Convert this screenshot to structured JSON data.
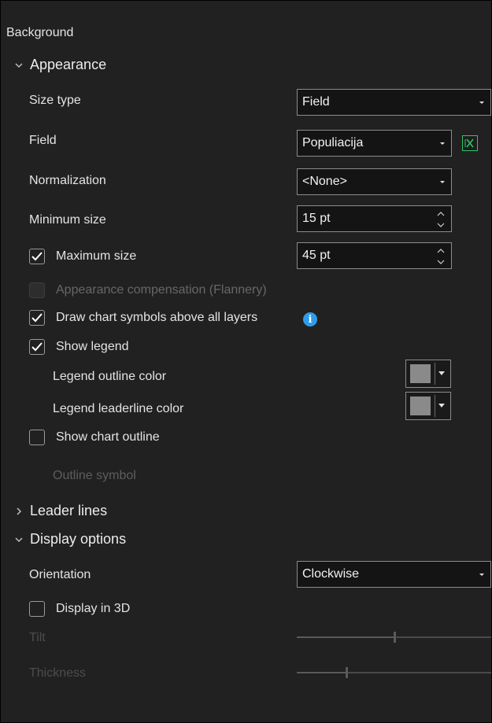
{
  "header": {
    "title": "Background"
  },
  "appearance": {
    "section_title": "Appearance",
    "size_type": {
      "label": "Size type",
      "value": "Field"
    },
    "field": {
      "label": "Field",
      "value": "Populiacija"
    },
    "normalization": {
      "label": "Normalization",
      "value": "<None>"
    },
    "minimum_size": {
      "label": "Minimum size",
      "value": "15 pt"
    },
    "maximum_size": {
      "label": "Maximum size",
      "value": "45 pt",
      "checked": true
    },
    "appearance_compensation": {
      "label": "Appearance compensation (Flannery)",
      "checked": false,
      "enabled": false
    },
    "draw_above": {
      "label": "Draw chart symbols above all layers",
      "checked": true
    },
    "show_legend": {
      "label": "Show legend",
      "checked": true
    },
    "legend_outline_color": {
      "label": "Legend outline color",
      "color": "#8a8a8a"
    },
    "legend_leaderline_color": {
      "label": "Legend leaderline color",
      "color": "#8a8a8a"
    },
    "show_chart_outline": {
      "label": "Show chart outline",
      "checked": false
    },
    "outline_symbol": {
      "label": "Outline symbol"
    }
  },
  "leader_lines": {
    "section_title": "Leader lines"
  },
  "display_options": {
    "section_title": "Display options",
    "orientation": {
      "label": "Orientation",
      "value": "Clockwise"
    },
    "display_3d": {
      "label": "Display in 3D",
      "checked": false
    },
    "tilt": {
      "label": "Tilt"
    },
    "thickness": {
      "label": "Thickness"
    }
  },
  "colors": {
    "accent_info": "#2f9bea",
    "expression_icon": "#30c56a",
    "panel_bg": "#212121"
  }
}
